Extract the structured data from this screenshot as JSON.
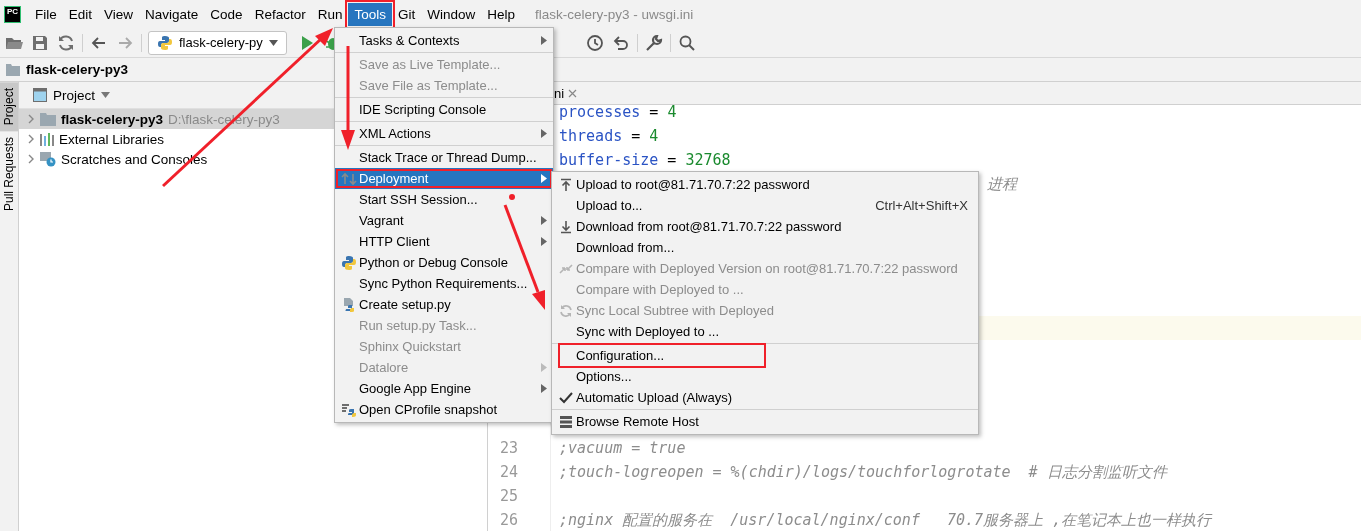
{
  "menubar": {
    "logo": "PC",
    "title": "flask-celery-py3 - uwsgi.ini",
    "items": [
      {
        "label": "File",
        "selected": false,
        "annotated": false
      },
      {
        "label": "Edit",
        "selected": false,
        "annotated": false
      },
      {
        "label": "View",
        "selected": false,
        "annotated": false
      },
      {
        "label": "Navigate",
        "selected": false,
        "annotated": false
      },
      {
        "label": "Code",
        "selected": false,
        "annotated": false
      },
      {
        "label": "Refactor",
        "selected": false,
        "annotated": false
      },
      {
        "label": "Run",
        "selected": false,
        "annotated": false
      },
      {
        "label": "Tools",
        "selected": true,
        "annotated": true
      },
      {
        "label": "Git",
        "selected": false,
        "annotated": false
      },
      {
        "label": "Window",
        "selected": false,
        "annotated": false
      },
      {
        "label": "Help",
        "selected": false,
        "annotated": false
      }
    ]
  },
  "toolbar": {
    "run_config": "flask-celery-py"
  },
  "breadcrumb": "flask-celery-py3",
  "tool_strip": [
    {
      "label": "Project",
      "selected": true
    },
    {
      "label": "Pull Requests",
      "selected": false
    }
  ],
  "project_panel": {
    "view": "Project",
    "tree": [
      {
        "kind": "folder",
        "label": "flask-celery-py3",
        "path": "D:\\flask-celery-py3",
        "selected": true
      },
      {
        "kind": "libraries",
        "label": "External Libraries",
        "selected": false
      },
      {
        "kind": "scratches",
        "label": "Scratches and Consoles",
        "selected": false
      }
    ]
  },
  "editor": {
    "tab": "ni",
    "lines": [
      {
        "kind": "code",
        "segments": [
          {
            "text": "processes",
            "kind": "key"
          },
          {
            "text": " = ",
            "kind": "op"
          },
          {
            "text": "4",
            "kind": "num"
          }
        ]
      },
      {
        "kind": "code",
        "segments": [
          {
            "text": "threads",
            "kind": "key"
          },
          {
            "text": " = ",
            "kind": "op"
          },
          {
            "text": "4",
            "kind": "num"
          }
        ]
      },
      {
        "kind": "code",
        "segments": [
          {
            "text": "buffer-size",
            "kind": "key"
          },
          {
            "text": " = ",
            "kind": "op"
          },
          {
            "text": "32768",
            "kind": "num"
          }
        ]
      },
      {
        "kind": "tail",
        "segments": [
          {
            "text": "进程",
            "kind": "comment"
          }
        ]
      },
      {
        "kind": "blank"
      },
      {
        "kind": "blank"
      },
      {
        "kind": "blank"
      },
      {
        "kind": "blank"
      },
      {
        "kind": "blank"
      },
      {
        "kind": "current"
      },
      {
        "kind": "blank"
      },
      {
        "kind": "blank"
      },
      {
        "kind": "blank"
      },
      {
        "kind": "blank"
      },
      {
        "kind": "code",
        "number": "23",
        "segments": [
          {
            "text": ";vacuum = true",
            "kind": "comment"
          }
        ]
      },
      {
        "kind": "code",
        "number": "24",
        "segments": [
          {
            "text": ";touch-logreopen = %(chdir)/logs/touchforlogrotate  # 日志分割监听文件",
            "kind": "comment"
          }
        ]
      },
      {
        "kind": "code",
        "number": "25"
      },
      {
        "kind": "code",
        "number": "26",
        "segments": [
          {
            "text": ";nginx 配置的服务在  /usr/local/nginx/conf   70.7服务器上 ,在笔记本上也一样执行",
            "kind": "comment"
          }
        ]
      }
    ]
  },
  "tools_menu": {
    "items": [
      {
        "kind": "item",
        "label": "Tasks & Contexts",
        "submenu": true,
        "disabled": false,
        "selected": false
      },
      {
        "kind": "separator"
      },
      {
        "kind": "item",
        "label": "Save as Live Template...",
        "disabled": true,
        "selected": false
      },
      {
        "kind": "item",
        "label": "Save File as Template...",
        "disabled": true,
        "selected": false
      },
      {
        "kind": "separator"
      },
      {
        "kind": "item",
        "label": "IDE Scripting Console",
        "disabled": false,
        "selected": false
      },
      {
        "kind": "separator"
      },
      {
        "kind": "item",
        "label": "XML Actions",
        "submenu": true,
        "disabled": false,
        "selected": false
      },
      {
        "kind": "separator"
      },
      {
        "kind": "item",
        "label": "Stack Trace or Thread Dump...",
        "disabled": false,
        "selected": false
      },
      {
        "kind": "item",
        "label": "Deployment",
        "submenu": true,
        "disabled": false,
        "selected": true,
        "annotated": true
      },
      {
        "kind": "item",
        "label": "Start SSH Session...",
        "disabled": false,
        "selected": false
      },
      {
        "kind": "item",
        "label": "Vagrant",
        "submenu": true,
        "disabled": false,
        "selected": false
      },
      {
        "kind": "item",
        "label": "HTTP Client",
        "submenu": true,
        "disabled": false,
        "selected": false
      },
      {
        "kind": "item",
        "label": "Python or Debug Console",
        "disabled": false,
        "selected": false
      },
      {
        "kind": "item",
        "label": "Sync Python Requirements...",
        "disabled": false,
        "selected": false
      },
      {
        "kind": "item",
        "label": "Create setup.py",
        "disabled": false,
        "selected": false
      },
      {
        "kind": "item",
        "label": "Run setup.py Task...",
        "disabled": true,
        "selected": false
      },
      {
        "kind": "item",
        "label": "Sphinx Quickstart",
        "disabled": true,
        "selected": false
      },
      {
        "kind": "item",
        "label": "Datalore",
        "submenu": true,
        "disabled": true,
        "selected": false
      },
      {
        "kind": "item",
        "label": "Google App Engine",
        "submenu": true,
        "disabled": false,
        "selected": false
      },
      {
        "kind": "item",
        "label": "Open CProfile snapshot",
        "disabled": false,
        "selected": false
      }
    ]
  },
  "deployment_menu": {
    "items": [
      {
        "kind": "item",
        "label": "Upload to root@81.71.70.7:22 password",
        "disabled": false
      },
      {
        "kind": "item",
        "label": "Upload to...",
        "shortcut": "Ctrl+Alt+Shift+X",
        "disabled": false
      },
      {
        "kind": "item",
        "label": "Download from root@81.71.70.7:22 password",
        "disabled": false
      },
      {
        "kind": "item",
        "label": "Download from...",
        "disabled": false
      },
      {
        "kind": "item",
        "label": "Compare with Deployed Version on root@81.71.70.7:22 password",
        "disabled": true
      },
      {
        "kind": "item",
        "label": "Compare with Deployed to ...",
        "disabled": true
      },
      {
        "kind": "item",
        "label": "Sync Local Subtree with Deployed",
        "disabled": true
      },
      {
        "kind": "item",
        "label": "Sync with Deployed to ...",
        "disabled": false
      },
      {
        "kind": "separator"
      },
      {
        "kind": "item",
        "label": "Configuration...",
        "disabled": false,
        "annotated": true
      },
      {
        "kind": "item",
        "label": "Options...",
        "disabled": false
      },
      {
        "kind": "item",
        "label": "Automatic Upload (Always)",
        "disabled": false,
        "checked": true
      },
      {
        "kind": "separator"
      },
      {
        "kind": "item",
        "label": "Browse Remote Host",
        "disabled": false
      }
    ]
  }
}
